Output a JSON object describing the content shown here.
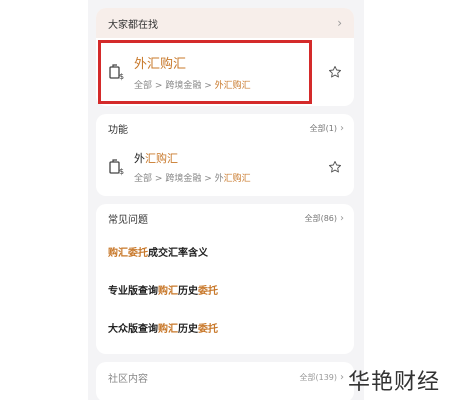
{
  "top_section": {
    "title": "大家都在找",
    "item": {
      "title_hl": "外汇购汇",
      "path": {
        "p1": "全部",
        "p2": "跨境金融",
        "p3": "外汇购汇"
      }
    }
  },
  "functions": {
    "title": "功能",
    "all_label": "全部(1)",
    "item": {
      "title_plain": "外",
      "title_hl": "汇购汇",
      "path": {
        "p1": "全部",
        "p2": "跨境金融",
        "p3_plain": "外",
        "p3_hl": "汇购汇"
      }
    }
  },
  "faq": {
    "title": "常见问题",
    "all_label": "全部(86)",
    "items": [
      {
        "a_hl": "购汇委托",
        "b": "成交汇率含义",
        "c_hl": "",
        "d": "",
        "e_hl": ""
      },
      {
        "a_hl": "",
        "b": "专业版查询",
        "c_hl": "购汇",
        "d": "历史",
        "e_hl": "委托"
      },
      {
        "a_hl": "",
        "b": "大众版查询",
        "c_hl": "购汇",
        "d": "历史",
        "e_hl": "委托"
      }
    ]
  },
  "community": {
    "title": "社区内容",
    "all_label": "全部(139)"
  },
  "watermark": "华艳财经",
  "separator": ">",
  "colors": {
    "accent": "#c8782a",
    "highlight_border": "#d42a2a",
    "top_header_bg": "#f7eeea"
  }
}
